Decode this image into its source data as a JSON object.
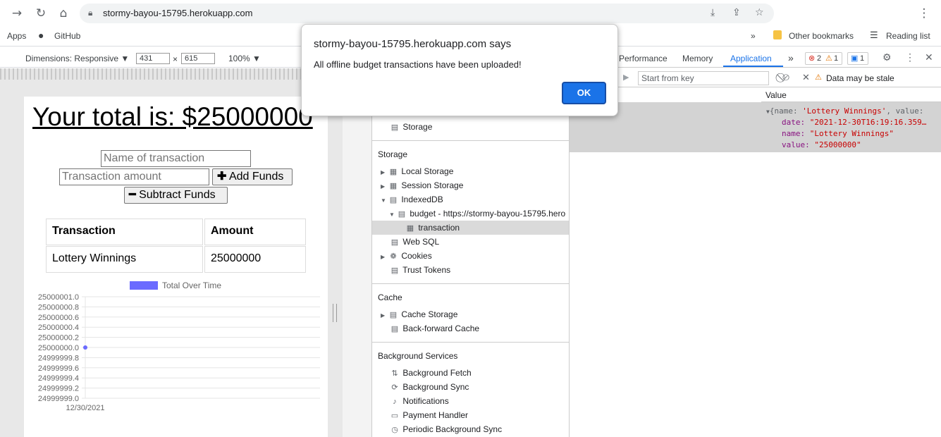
{
  "browser": {
    "url": "stormy-bayou-15795.herokuapp.com",
    "bookmarks": {
      "apps": "Apps",
      "github": "GitHub",
      "more": "»",
      "other": "Other bookmarks",
      "reading": "Reading list"
    }
  },
  "device_toolbar": {
    "dimensions_label": "Dimensions: Responsive ▼",
    "width": "431",
    "times": "×",
    "height": "615",
    "zoom": "100% ▼"
  },
  "app": {
    "total_label": "Your total is: $25000000",
    "name_placeholder": "Name of transaction",
    "amount_placeholder": "Transaction amount",
    "add_button": "Add Funds",
    "subtract_button": "Subtract Funds",
    "table": {
      "headers": [
        "Transaction",
        "Amount"
      ],
      "rows": [
        [
          "Lottery Winnings",
          "25000000"
        ]
      ]
    }
  },
  "chart_data": {
    "type": "line",
    "legend": "Total Over Time",
    "categories": [
      "12/30/2021"
    ],
    "series": [
      {
        "name": "Total Over Time",
        "values": [
          25000000
        ]
      }
    ],
    "ticks": [
      "25000001.0",
      "25000000.8",
      "25000000.6",
      "25000000.4",
      "25000000.2",
      "25000000.0",
      "24999999.8",
      "24999999.6",
      "24999999.4",
      "24999999.2",
      "24999999.0"
    ],
    "ylim": [
      24999999.0,
      25000001.0
    ],
    "color": "#6b6bff"
  },
  "devtools": {
    "tabs": {
      "performance": "Performance",
      "memory": "Memory",
      "application": "Application",
      "more": "»",
      "errors": "2",
      "warnings": "1",
      "messages": "1"
    },
    "sidebar": {
      "storage_top": "Storage",
      "storage_section": "Storage",
      "local_storage": "Local Storage",
      "session_storage": "Session Storage",
      "indexeddb": "IndexedDB",
      "budget_db": "budget - https://stormy-bayou-15795.hero",
      "transaction_store": "transaction",
      "web_sql": "Web SQL",
      "cookies": "Cookies",
      "trust_tokens": "Trust Tokens",
      "cache_section": "Cache",
      "cache_storage": "Cache Storage",
      "bf_cache": "Back-forward Cache",
      "bg_section": "Background Services",
      "bg_fetch": "Background Fetch",
      "bg_sync": "Background Sync",
      "notifications": "Notifications",
      "payment_handler": "Payment Handler",
      "periodic_sync": "Periodic Background Sync"
    },
    "data_view": {
      "start_key_placeholder": "Start from key",
      "stale_warning": "Data may be stale",
      "value_column": "Value",
      "record_summary_pre": "{name: ",
      "record_summary_name": "'Lottery Winnings'",
      "record_summary_post": ", value:",
      "date_key": "date:",
      "date_val": "\"2021-12-30T16:19:16.359…",
      "name_key": "name:",
      "name_val": "\"Lottery Winnings\"",
      "value_key": "value:",
      "value_val": "\"25000000\""
    }
  },
  "dialog": {
    "title": "stormy-bayou-15795.herokuapp.com says",
    "message": "All offline budget transactions have been uploaded!",
    "ok": "OK"
  }
}
